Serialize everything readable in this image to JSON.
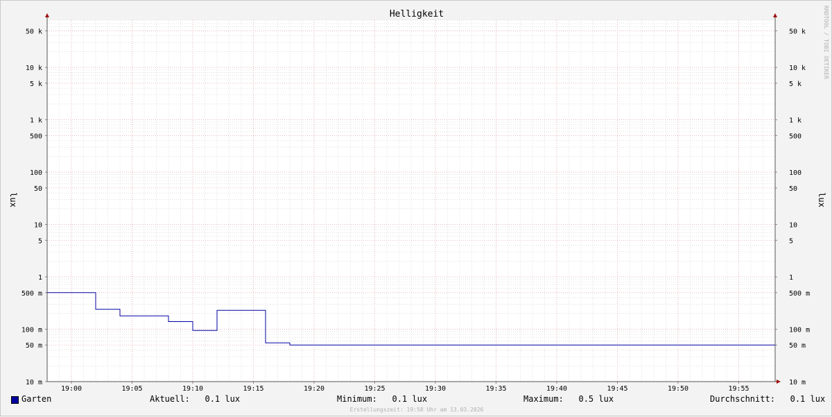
{
  "chart_data": {
    "type": "line",
    "title": "Helligkeit",
    "ylabel": "lux",
    "ylabel_right": "lux",
    "yscale": "log",
    "ylim": [
      0.01,
      80000
    ],
    "xlim": [
      "18:58",
      "19:58"
    ],
    "x_tick_labels": [
      "19:00",
      "19:05",
      "19:10",
      "19:15",
      "19:20",
      "19:25",
      "19:30",
      "19:35",
      "19:40",
      "19:45",
      "19:50",
      "19:55"
    ],
    "y_ticks": [
      {
        "value": 50000,
        "label": "50 k"
      },
      {
        "value": 10000,
        "label": "10 k"
      },
      {
        "value": 5000,
        "label": "5 k"
      },
      {
        "value": 1000,
        "label": "1 k"
      },
      {
        "value": 500,
        "label": "500"
      },
      {
        "value": 100,
        "label": "100"
      },
      {
        "value": 50,
        "label": "50"
      },
      {
        "value": 10,
        "label": "10"
      },
      {
        "value": 5,
        "label": "5"
      },
      {
        "value": 1,
        "label": "1"
      },
      {
        "value": 0.5,
        "label": "500 m"
      },
      {
        "value": 0.1,
        "label": "100 m"
      },
      {
        "value": 0.05,
        "label": "50 m"
      },
      {
        "value": 0.01,
        "label": "10 m"
      }
    ],
    "grid": true,
    "series": [
      {
        "name": "Garten",
        "color": "#0000a0",
        "x": [
          "18:58",
          "19:02",
          "19:04",
          "19:08",
          "19:10",
          "19:12",
          "19:16",
          "19:18",
          "19:58"
        ],
        "y": [
          0.5,
          0.24,
          0.18,
          0.14,
          0.095,
          0.23,
          0.055,
          0.05,
          0.05
        ]
      }
    ]
  },
  "legend": {
    "series_name": "Garten",
    "current": "Aktuell:   0.1 lux",
    "minimum": "Minimum:   0.1 lux",
    "maximum": "Maximum:   0.5 lux",
    "average": "Durchschnitt:   0.1 lux"
  },
  "watermark": "RRDTOOL / TOBI OETIKER",
  "footer": "Erstellungszeit: 19:58 Uhr am 13.03.2026",
  "colors": {
    "line": "#0000a0",
    "major_grid": "#e8a0a8",
    "minor_grid": "#cccccc",
    "arrow": "#a01010"
  }
}
